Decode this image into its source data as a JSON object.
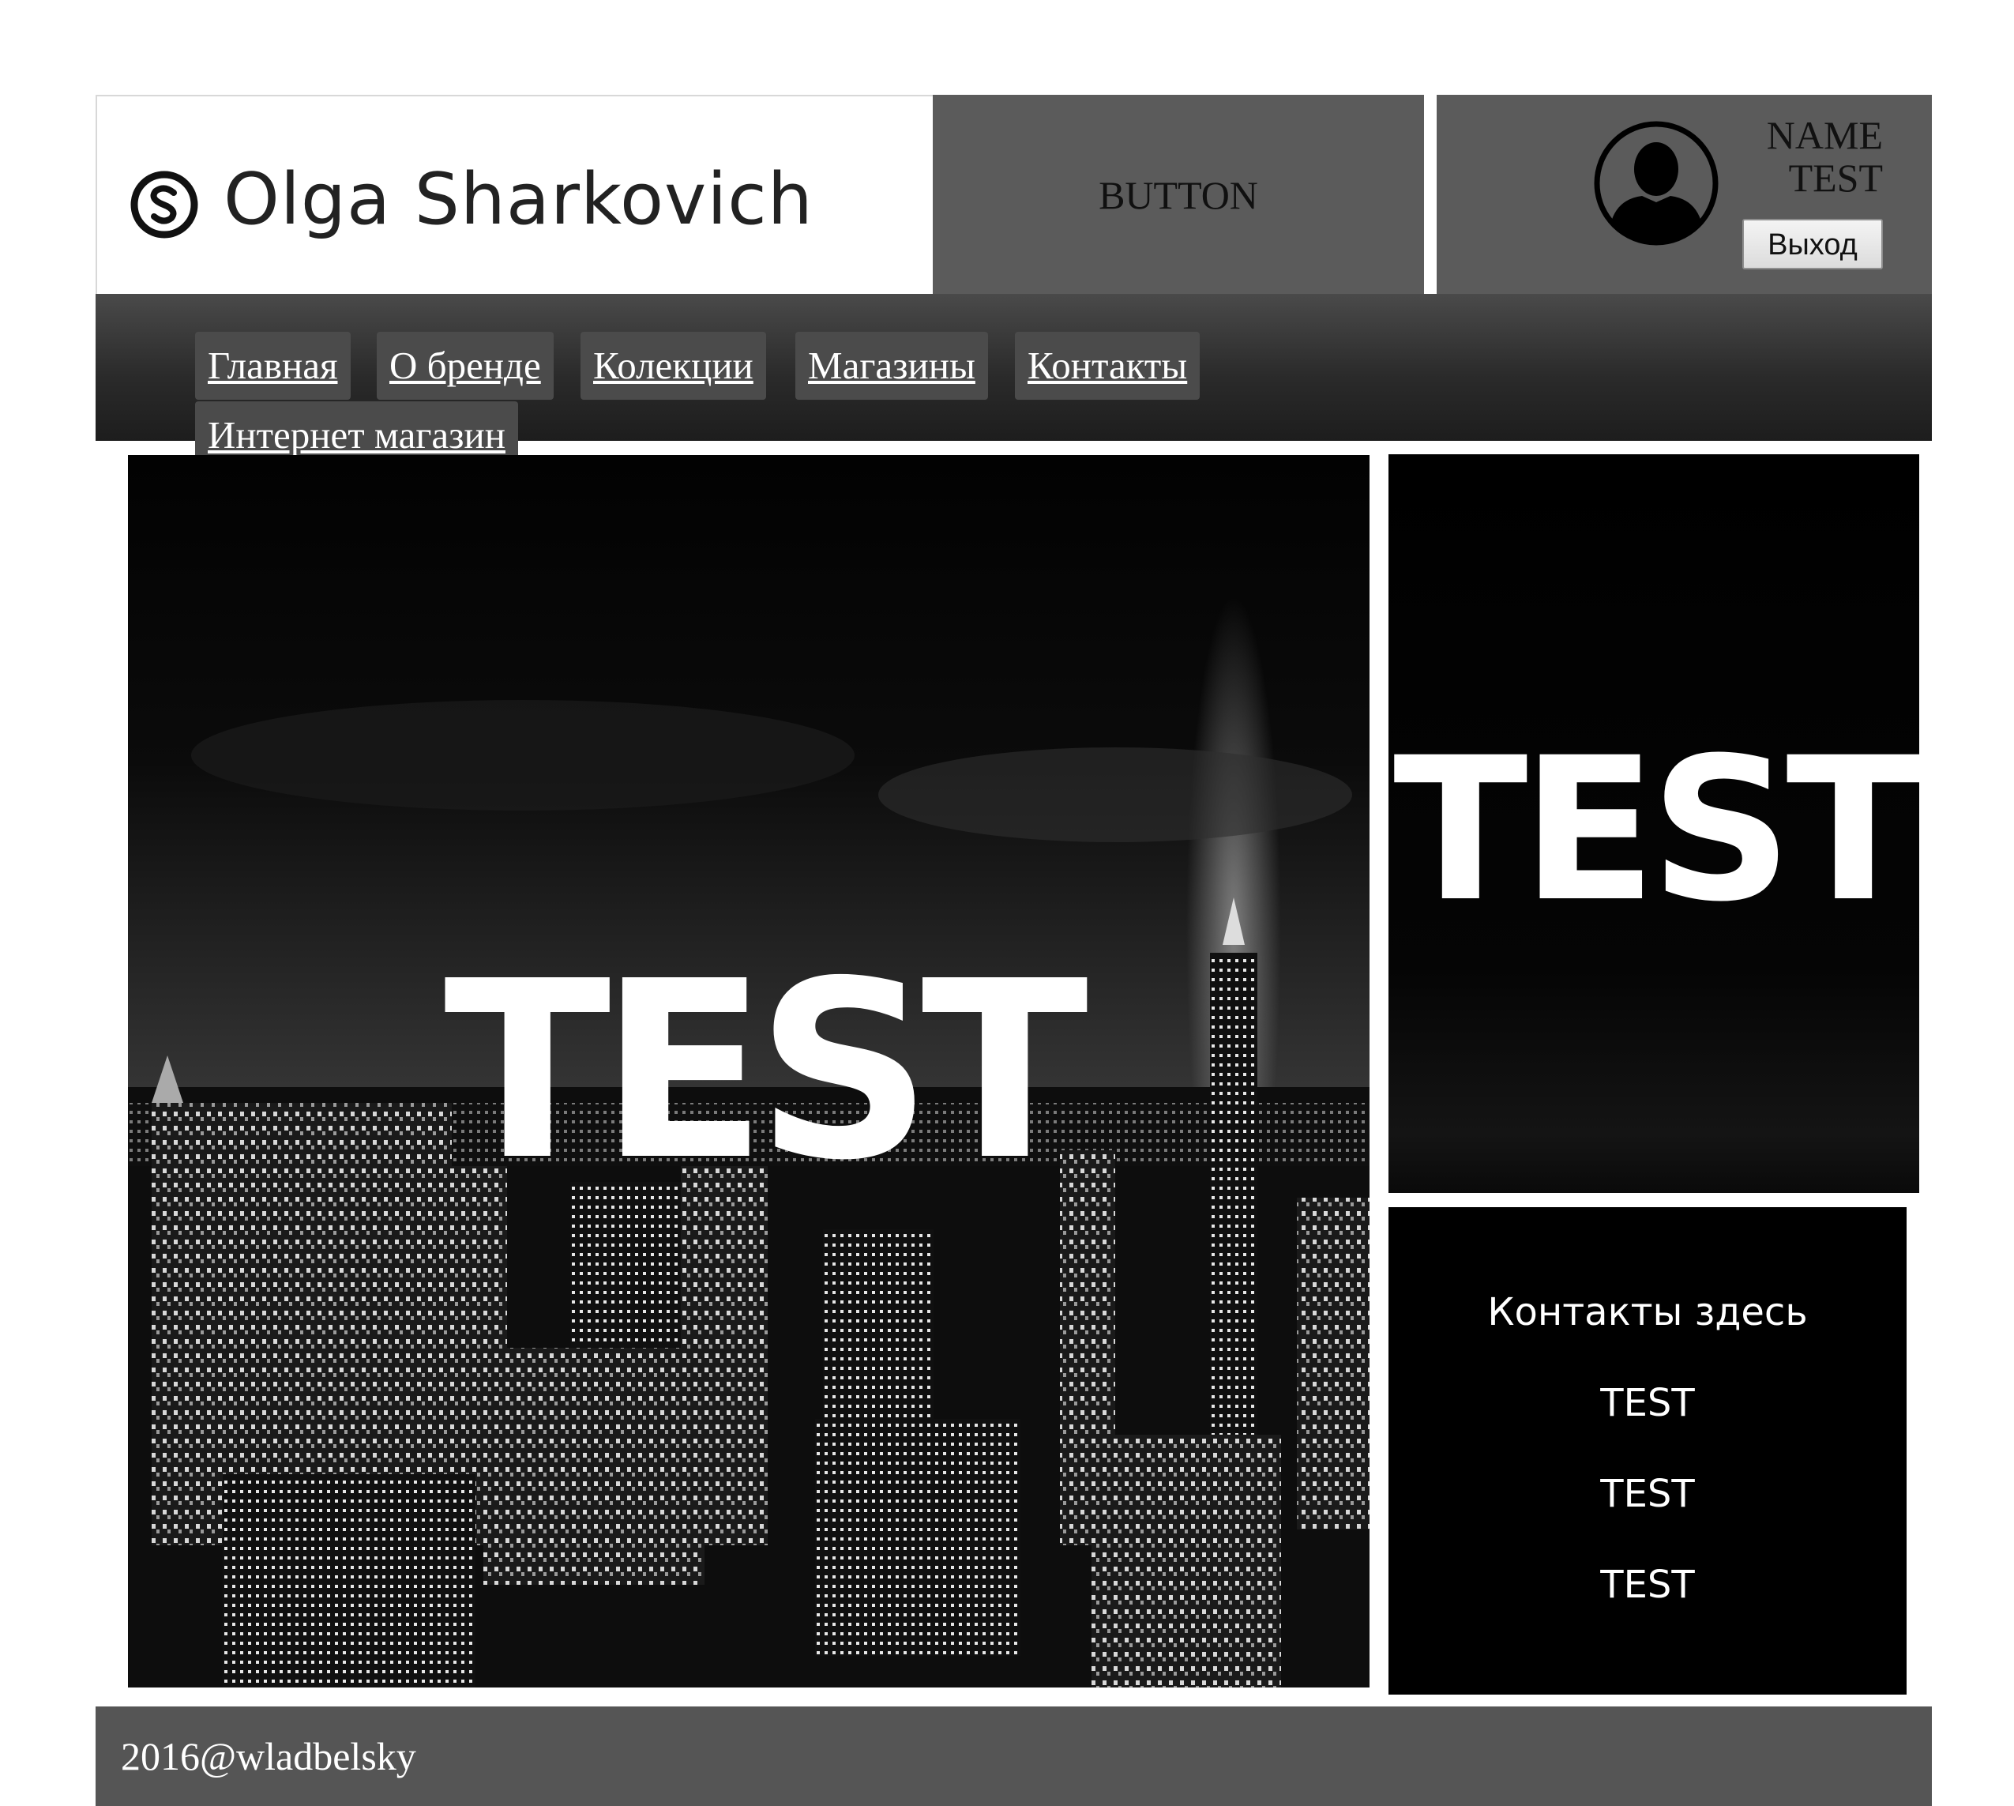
{
  "header": {
    "logo_text": "Olga Sharkovich",
    "button_label": "BUTTON",
    "user": {
      "name_line1": "NAME",
      "name_line2": "TEST",
      "logout_label": "Выход"
    }
  },
  "nav": {
    "items": [
      {
        "label": "Главная"
      },
      {
        "label": "О бренде"
      },
      {
        "label": "Колекции"
      },
      {
        "label": "Магазины"
      },
      {
        "label": "Контакты"
      },
      {
        "label": "Интернет магазин"
      }
    ]
  },
  "hero": {
    "title": "TEST"
  },
  "side": {
    "title": "TEST",
    "contacts_heading": "Контакты здесь",
    "contacts": [
      "TEST",
      "TEST",
      "TEST"
    ]
  },
  "footer": {
    "text": "2016@wladbelsky"
  },
  "colors": {
    "header_panel": "#5b5b5b",
    "nav_bg": "#2b2b2b",
    "nav_item_bg": "#4b4b4b",
    "footer_bg": "#555555",
    "panel_bg": "#000000"
  }
}
